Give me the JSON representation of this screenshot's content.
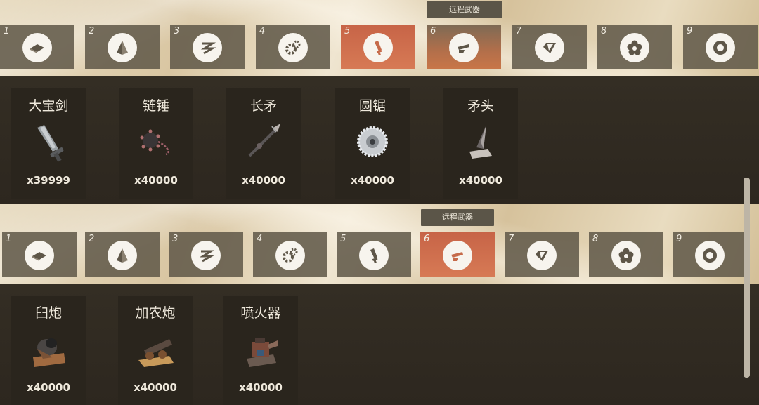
{
  "section1": {
    "title": "远程武器",
    "tabs": [
      {
        "num": "1",
        "icon": "plate-icon",
        "active": false
      },
      {
        "num": "2",
        "icon": "pyramid-icon",
        "active": false
      },
      {
        "num": "3",
        "icon": "zigzag-icon",
        "active": false
      },
      {
        "num": "4",
        "icon": "gears-icon",
        "active": false
      },
      {
        "num": "5",
        "icon": "sword-icon",
        "active": true
      },
      {
        "num": "6",
        "icon": "cannon-icon",
        "active": false
      },
      {
        "num": "7",
        "icon": "diamond-icon",
        "active": false
      },
      {
        "num": "8",
        "icon": "flower-icon",
        "active": false
      },
      {
        "num": "9",
        "icon": "burst-icon",
        "active": false
      }
    ],
    "items": [
      {
        "name": "大宝剑",
        "qty": "x39999",
        "icon": "great-sword-icon"
      },
      {
        "name": "链锤",
        "qty": "x40000",
        "icon": "flail-icon"
      },
      {
        "name": "长矛",
        "qty": "x40000",
        "icon": "spear-icon"
      },
      {
        "name": "圆锯",
        "qty": "x40000",
        "icon": "saw-icon"
      },
      {
        "name": "矛头",
        "qty": "x40000",
        "icon": "spearhead-icon"
      }
    ]
  },
  "section2": {
    "title": "远程武器",
    "tabs": [
      {
        "num": "1",
        "icon": "plate-icon",
        "active": false
      },
      {
        "num": "2",
        "icon": "pyramid-icon",
        "active": false
      },
      {
        "num": "3",
        "icon": "zigzag-icon",
        "active": false
      },
      {
        "num": "4",
        "icon": "gears-icon",
        "active": false
      },
      {
        "num": "5",
        "icon": "sword-icon",
        "active": false
      },
      {
        "num": "6",
        "icon": "cannon-icon",
        "active": true
      },
      {
        "num": "7",
        "icon": "diamond-icon",
        "active": false
      },
      {
        "num": "8",
        "icon": "flower-icon",
        "active": false
      },
      {
        "num": "9",
        "icon": "burst-icon",
        "active": false
      }
    ],
    "items": [
      {
        "name": "臼炮",
        "qty": "x40000",
        "icon": "mortar-icon"
      },
      {
        "name": "加农炮",
        "qty": "x40000",
        "icon": "cannon-item-icon"
      },
      {
        "name": "喷火器",
        "qty": "x40000",
        "icon": "flamethrower-icon"
      }
    ]
  },
  "colors": {
    "active_tab": "#c96a48",
    "tab": "#625a4a",
    "panel": "#2f2a22"
  }
}
